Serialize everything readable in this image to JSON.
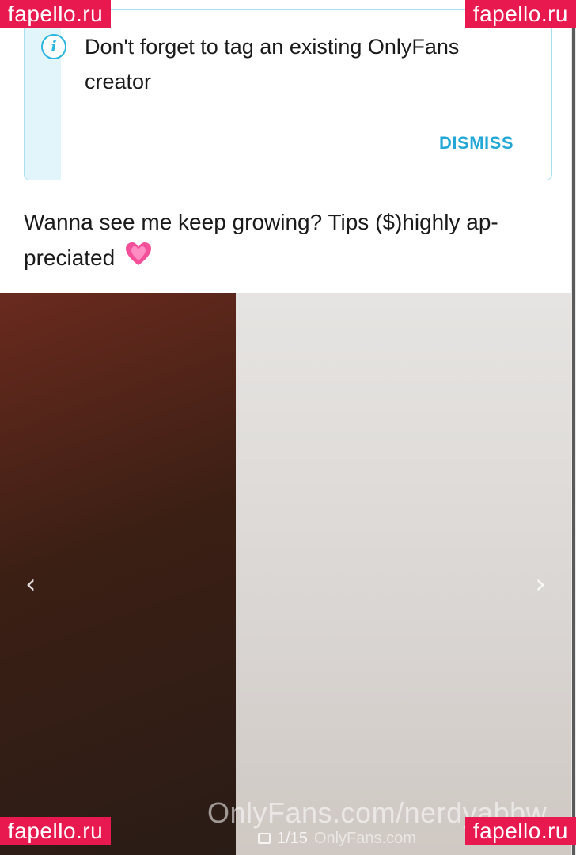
{
  "notice": {
    "message": "Don't forget to tag an existing OnlyFans creator",
    "dismiss_label": "DISMISS",
    "icon": "info-icon",
    "accent_color": "#2bb6e0"
  },
  "post": {
    "caption": "Wanna see me keep growing? Tips ($)highly ap­preciated",
    "emoji": "growing-heart-icon"
  },
  "gallery": {
    "watermark": "OnlyFans.com/nerdyabbw",
    "counter": "1/15",
    "counter_suffix": "OnlyFans.com",
    "prev_icon": "chevron-left-icon",
    "next_icon": "chevron-right-icon"
  },
  "watermarks": {
    "site": "fapello.ru",
    "color": "#e8194f"
  }
}
